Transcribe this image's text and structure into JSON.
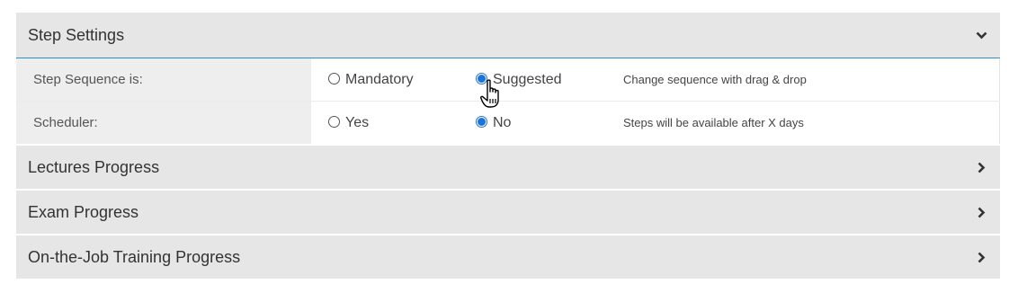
{
  "sections": {
    "step_settings": {
      "title": "Step Settings"
    },
    "lectures": {
      "title": "Lectures Progress"
    },
    "exam": {
      "title": "Exam Progress"
    },
    "ojt": {
      "title": "On-the-Job Training Progress"
    }
  },
  "step_sequence": {
    "label": "Step Sequence is:",
    "options": [
      {
        "label": "Mandatory",
        "checked": false
      },
      {
        "label": "Suggested",
        "checked": true
      }
    ],
    "hint": "Change sequence with drag & drop"
  },
  "scheduler": {
    "label": "Scheduler:",
    "options": [
      {
        "label": "Yes",
        "checked": false
      },
      {
        "label": "No",
        "checked": true
      }
    ],
    "hint": "Steps will be available after X days"
  },
  "icons": {
    "expanded": "chevron-down-icon",
    "collapsed": "chevron-right-icon",
    "pointer": "hand-pointer-icon"
  },
  "colors": {
    "accent": "#1a73d8",
    "header_bg": "#e6e6e6",
    "label_bg": "#eeeeee"
  }
}
